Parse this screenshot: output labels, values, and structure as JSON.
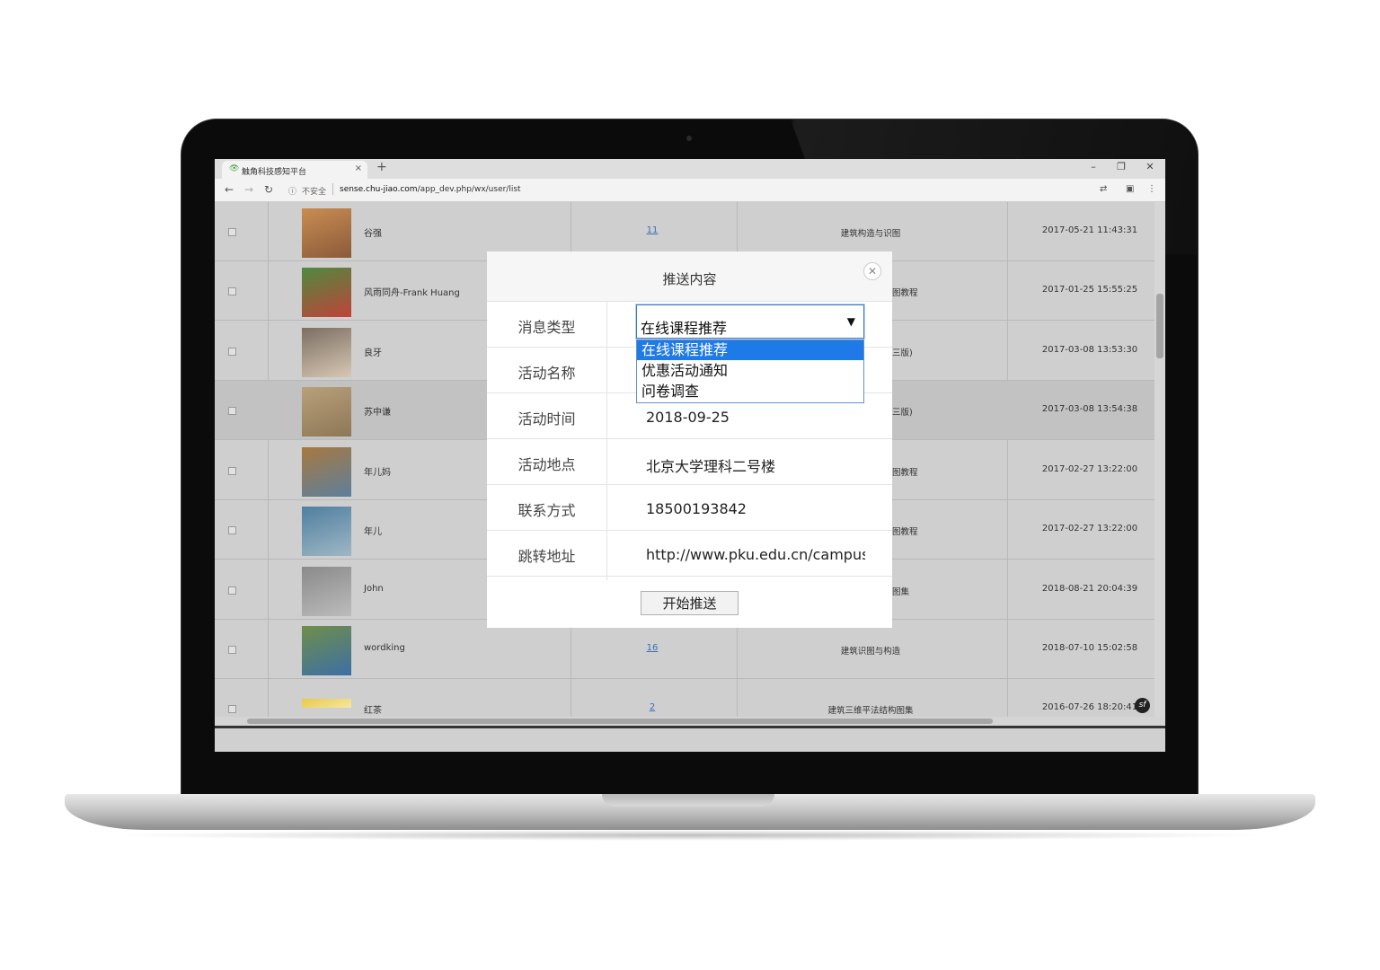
{
  "browser": {
    "tab_title": "触角科技感知平台",
    "tab_close": "×",
    "new_tab": "+",
    "insecure_label": "不安全",
    "url_domain": "sense.chu-jiao.com",
    "url_path": "/app_dev.php/wx/user/list",
    "win_minimize": "–",
    "win_restore": "❐",
    "win_close": "✕"
  },
  "table": {
    "rows": [
      {
        "name": "谷强",
        "count": "11",
        "course": "建筑构造与识图",
        "time": "2017-05-21 11:43:31"
      },
      {
        "name": "风雨同舟-Frank Huang",
        "count": "",
        "course": "图教程",
        "time": "2017-01-25 15:55:25"
      },
      {
        "name": "良牙",
        "count": "",
        "course": "三版)",
        "time": "2017-03-08 13:53:30"
      },
      {
        "name": "苏中谦",
        "count": "",
        "course": "三版)",
        "time": "2017-03-08 13:54:38"
      },
      {
        "name": "年儿妈",
        "count": "",
        "course": "图教程",
        "time": "2017-02-27 13:22:00"
      },
      {
        "name": "年儿",
        "count": "",
        "course": "图教程",
        "time": "2017-02-27 13:22:00"
      },
      {
        "name": "John",
        "count": "",
        "course": "图集",
        "time": "2018-08-21 20:04:39"
      },
      {
        "name": "wordking",
        "count": "16",
        "course": "建筑识图与构造",
        "time": "2018-07-10 15:02:58"
      },
      {
        "name": "红茶",
        "count": "2",
        "course": "建筑三维平法结构图集",
        "time": "2016-07-26 18:20:41"
      }
    ]
  },
  "modal": {
    "title": "推送内容",
    "fields": {
      "type_label": "消息类型",
      "name_label": "活动名称",
      "time_label": "活动时间",
      "time_value": "2018-09-25",
      "place_label": "活动地点",
      "place_value": "北京大学理科二号楼",
      "contact_label": "联系方式",
      "contact_value": "18500193842",
      "url_label": "跳转地址",
      "url_value": "http://www.pku.edu.cn/campus"
    },
    "select": {
      "value": "在线课程推荐",
      "options": [
        "在线课程推荐",
        "优惠活动通知",
        "问卷调查"
      ],
      "selected_index": 0
    },
    "submit_label": "开始推送"
  },
  "colors": {
    "accent": "#1e7ae6",
    "link": "#3b6fb6",
    "overlay": "#cfcfcf"
  }
}
